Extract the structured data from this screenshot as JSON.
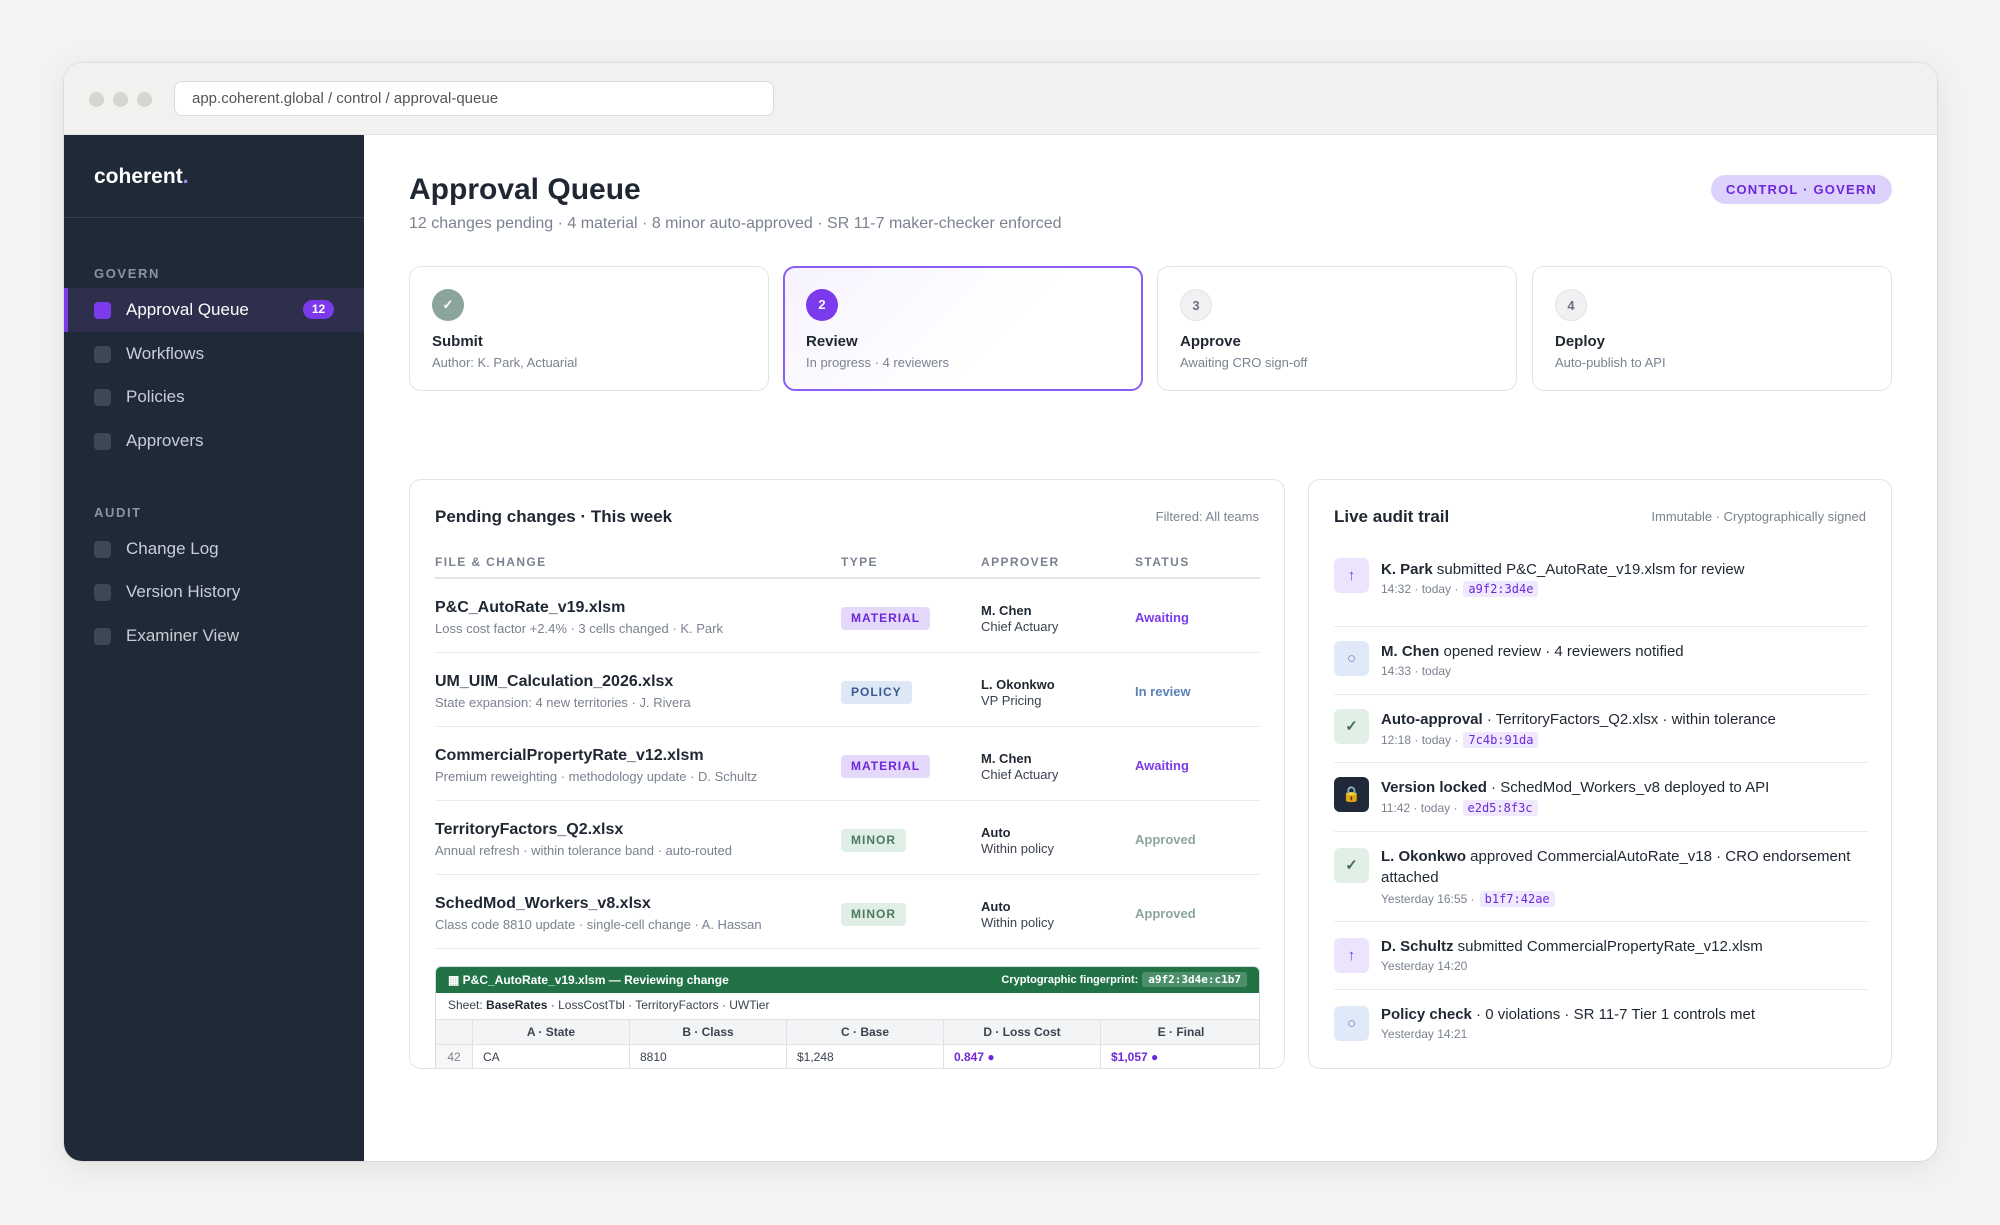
{
  "browser": {
    "url": "app.coherent.global / control / approval-queue"
  },
  "sidebar": {
    "brand": "coherent",
    "brand_dot": ".",
    "sections": [
      {
        "title": "GOVERN",
        "items": [
          {
            "label": "Approval Queue",
            "badge": "12",
            "active": true
          },
          {
            "label": "Workflows"
          },
          {
            "label": "Policies"
          },
          {
            "label": "Approvers"
          }
        ]
      },
      {
        "title": "AUDIT",
        "items": [
          {
            "label": "Change Log"
          },
          {
            "label": "Version History"
          },
          {
            "label": "Examiner View"
          }
        ]
      }
    ]
  },
  "header": {
    "title": "Approval Queue",
    "subtitle": "12 changes pending · 4 material · 8 minor auto-approved · SR 11-7 maker-checker enforced",
    "badge": "CONTROL · GOVERN"
  },
  "steps": [
    {
      "marker": "✓",
      "state": "done",
      "title": "Submit",
      "desc": "Author: K. Park, Actuarial"
    },
    {
      "marker": "2",
      "state": "current",
      "title": "Review",
      "desc": "In progress · 4 reviewers"
    },
    {
      "marker": "3",
      "state": "todo",
      "title": "Approve",
      "desc": "Awaiting CRO sign-off"
    },
    {
      "marker": "4",
      "state": "todo",
      "title": "Deploy",
      "desc": "Auto-publish to API"
    }
  ],
  "pending": {
    "title": "Pending changes · This week",
    "filter": "Filtered: All teams",
    "columns": [
      "FILE & CHANGE",
      "TYPE",
      "APPROVER",
      "STATUS"
    ],
    "rows": [
      {
        "file": "P&C_AutoRate_v19.xlsm",
        "desc": "Loss cost factor +2.4% · 3 cells changed · K. Park",
        "type": "MATERIAL",
        "approver": "M. Chen",
        "role": "Chief Actuary",
        "status": "Awaiting"
      },
      {
        "file": "UM_UIM_Calculation_2026.xlsx",
        "desc": "State expansion: 4 new territories · J. Rivera",
        "type": "POLICY",
        "approver": "L. Okonkwo",
        "role": "VP Pricing",
        "status": "In review"
      },
      {
        "file": "CommercialPropertyRate_v12.xlsm",
        "desc": "Premium reweighting · methodology update · D. Schultz",
        "type": "MATERIAL",
        "approver": "M. Chen",
        "role": "Chief Actuary",
        "status": "Awaiting"
      },
      {
        "file": "TerritoryFactors_Q2.xlsx",
        "desc": "Annual refresh · within tolerance band · auto-routed",
        "type": "MINOR",
        "approver": "Auto",
        "role": "Within policy",
        "status": "Approved"
      },
      {
        "file": "SchedMod_Workers_v8.xlsx",
        "desc": "Class code 8810 update · single-cell change · A. Hassan",
        "type": "MINOR",
        "approver": "Auto",
        "role": "Within policy",
        "status": "Approved"
      }
    ],
    "sheet": {
      "title": "P&C_AutoRate_v19.xlsm — Reviewing change",
      "fingerprint_label": "Cryptographic fingerprint:",
      "fingerprint": "a9f2:3d4e:c1b7",
      "sheet_label": "Sheet:",
      "active_sheet": "BaseRates",
      "other_sheets": "· LossCostTbl · TerritoryFactors · UWTier",
      "headers": [
        "A · State",
        "B · Class",
        "C · Base",
        "D · Loss Cost",
        "E · Final"
      ],
      "row": {
        "num": "42",
        "cells": [
          "CA",
          "8810",
          "$1,248",
          "0.847 ●",
          "$1,057 ●"
        ]
      }
    }
  },
  "audit": {
    "title": "Live audit trail",
    "meta": "Immutable · Cryptographically signed",
    "events": [
      {
        "icon": "↑",
        "kind": "up",
        "actor": "K. Park",
        "text": " submitted P&C_AutoRate_v19.xlsm for review",
        "time": "14:32 · today ·",
        "hash": "a9f2:3d4e"
      },
      {
        "icon": "○",
        "kind": "open",
        "actor": "M. Chen",
        "text": " opened review · 4 reviewers notified",
        "time": "14:33 · today",
        "hash": ""
      },
      {
        "icon": "✓",
        "kind": "check",
        "actor": "Auto-approval",
        "text": " · TerritoryFactors_Q2.xlsx · within tolerance",
        "time": "12:18 · today ·",
        "hash": "7c4b:91da"
      },
      {
        "icon": "🔒",
        "kind": "lock",
        "actor": "Version locked",
        "text": " · SchedMod_Workers_v8 deployed to API",
        "time": "11:42 · today ·",
        "hash": "e2d5:8f3c"
      },
      {
        "icon": "✓",
        "kind": "check",
        "actor": "L. Okonkwo",
        "text": " approved CommercialAutoRate_v18 · CRO endorsement attached",
        "time": "Yesterday 16:55 ·",
        "hash": "b1f7:42ae"
      },
      {
        "icon": "↑",
        "kind": "up",
        "actor": "D. Schultz",
        "text": " submitted CommercialPropertyRate_v12.xlsm",
        "time": "Yesterday 14:20",
        "hash": ""
      },
      {
        "icon": "○",
        "kind": "open",
        "actor": "Policy check",
        "text": " · 0 violations · SR 11-7 Tier 1 controls met",
        "time": "Yesterday 14:21",
        "hash": ""
      }
    ]
  }
}
